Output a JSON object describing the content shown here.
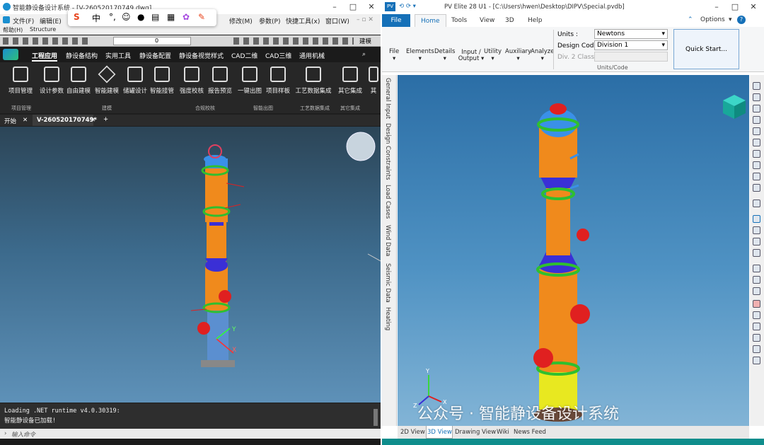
{
  "left_window": {
    "title": "智能静设备设计系统 - [V-260520170749.dwg]",
    "menu": [
      "文件(F)",
      "编辑(E)",
      "修改(M)",
      "参数(P)",
      "快捷工具(x)",
      "窗口(W)"
    ],
    "menu2": [
      "帮助(H)",
      "Structure"
    ],
    "layer_value": "0",
    "qat_right_label": "建模",
    "ime_label": "中",
    "ribbon_tabs": [
      "工程应用",
      "静设备结构",
      "实用工具",
      "静设备配置",
      "静设备视觉样式",
      "CAD二维",
      "CAD三维",
      "通用机械"
    ],
    "ribbon_buttons": [
      "项目管理",
      "设计参数",
      "自由建模",
      "智能建模",
      "储罐设计",
      "智能接管",
      "强度校核",
      "报告预览",
      "一键出图",
      "项目样板",
      "工艺数据集成",
      "其它集成",
      "其"
    ],
    "ribbon_groups": [
      "项目管理",
      "建模",
      "合规校核",
      "智能出图",
      "工艺数据集成",
      "其它集成"
    ],
    "doc_tabs": [
      "开始",
      "V-260520170749*"
    ],
    "console_lines": [
      "Loading .NET runtime v4.0.30319:",
      "智能静设备已加载!"
    ],
    "command_placeholder": "输入命令",
    "axis_labels": [
      "Y",
      "X"
    ]
  },
  "right_window": {
    "app_icon": "PV",
    "title": "PV Elite 28 U1 - [C:\\Users\\hwen\\Desktop\\DIPV\\Special.pvdb]",
    "file_tab": "File",
    "tabs": [
      "Home",
      "Tools",
      "View",
      "3D",
      "Help"
    ],
    "options_label": "Options",
    "ribbon_commands": [
      "File",
      "Elements",
      "Details",
      "Input / Output",
      "Utility",
      "Auxiliary",
      "Analyze"
    ],
    "units_label": "Units :",
    "units_value": "Newtons",
    "design_code_label": "Design Code :",
    "design_code_value": "Division 1",
    "div2_label": "Div. 2 Class:",
    "units_group_label": "Units/Code",
    "quick_start_label": "Quick Start...",
    "side_tabs": [
      "General Input",
      "Design Constraints",
      "Load Cases",
      "Wind Data",
      "Seismic Data",
      "Heating"
    ],
    "bottom_tabs": [
      "2D View",
      "3D View",
      "Drawing View",
      "Wiki",
      "News Feed"
    ],
    "axis_labels": [
      "Y",
      "X",
      "Z"
    ]
  },
  "watermark": "公众号 · 智能静设备设计系统",
  "colors": {
    "shell": "#f08a1c",
    "flange": "#2fbf2f",
    "cone": "#3a2fd6",
    "nozzle": "#e02020",
    "head": "#3a90e8",
    "skirt": "#e8e820",
    "accent_teal": "#0f8d8c"
  }
}
